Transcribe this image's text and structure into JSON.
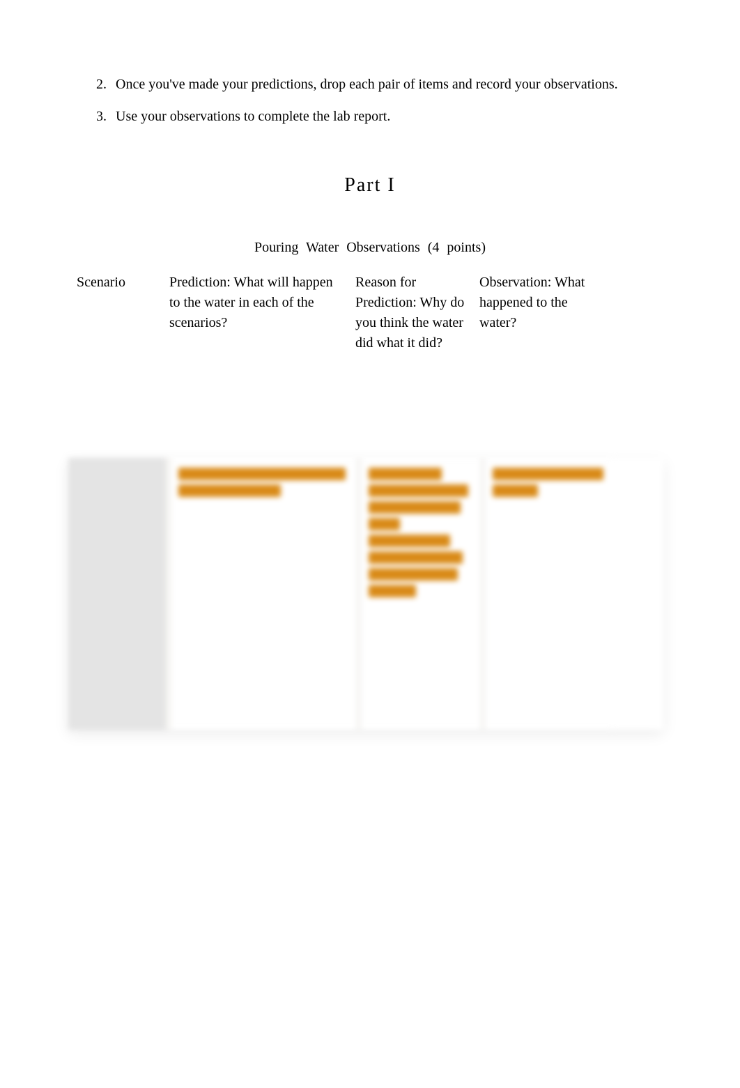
{
  "instructions": {
    "start": 2,
    "items": [
      "Once you've made your predictions, drop each pair of items and record your observations.",
      "Use your observations to complete the lab report."
    ]
  },
  "part_title": "Part  I",
  "table": {
    "title": "Pouring  Water  Observations   (4 points)",
    "headers": {
      "scenario": "Scenario",
      "prediction": "Prediction: What will happen to the water in each of the scenarios?",
      "reason": "Reason for Prediction: Why do you think the water did what it did?",
      "observation": "Observation: What happened to the water?"
    }
  }
}
